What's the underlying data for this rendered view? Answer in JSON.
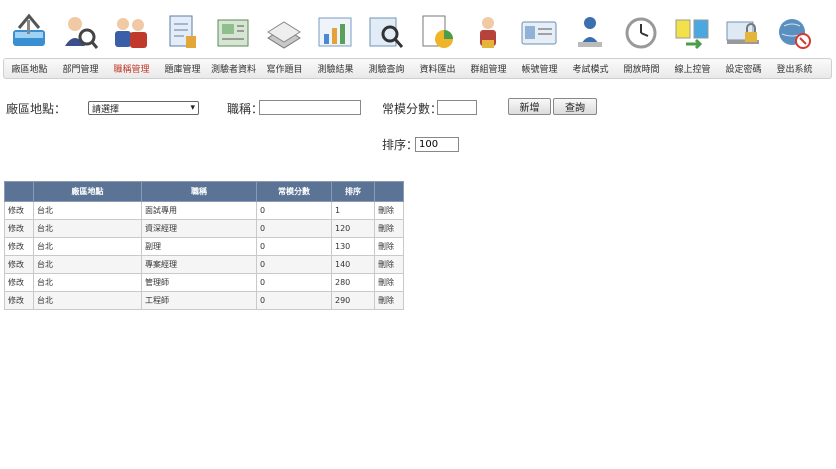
{
  "toolbar": {
    "icons": [
      "site-icon",
      "department-icon",
      "job-title-icon",
      "question-bank-icon",
      "examinee-icon",
      "exam-question-icon",
      "results-chart-icon",
      "query-icon",
      "export-icon",
      "group-icon",
      "account-card-icon",
      "exam-mode-icon",
      "clock-icon",
      "online-monitor-icon",
      "password-lock-icon",
      "logout-icon"
    ]
  },
  "menu": {
    "items": [
      "廠區地點",
      "部門管理",
      "職稱管理",
      "題庫管理",
      "測驗者資料",
      "寫作題目",
      "測驗結果",
      "測驗查詢",
      "資料匯出",
      "群組管理",
      "帳號管理",
      "考試模式",
      "開放時間",
      "線上控管",
      "設定密碼",
      "登出系統"
    ],
    "active_index": 2
  },
  "form": {
    "site_label": "廠區地點：",
    "site_value": "請選擇",
    "title_label": "職稱：",
    "title_value": "",
    "score_label": "常模分數：",
    "score_value": "",
    "add_button": "新增",
    "query_button": "查詢",
    "sort_label": "排序：",
    "sort_value": "100"
  },
  "table": {
    "headers": [
      "",
      "廠區地點",
      "職稱",
      "常模分數",
      "排序",
      ""
    ],
    "rows": [
      {
        "edit": "修改",
        "site": "台北",
        "title": "面試專用",
        "score": "0",
        "order": "1",
        "delete": "刪除"
      },
      {
        "edit": "修改",
        "site": "台北",
        "title": "資深經理",
        "score": "0",
        "order": "120",
        "delete": "刪除"
      },
      {
        "edit": "修改",
        "site": "台北",
        "title": "副理",
        "score": "0",
        "order": "130",
        "delete": "刪除"
      },
      {
        "edit": "修改",
        "site": "台北",
        "title": "專案經理",
        "score": "0",
        "order": "140",
        "delete": "刪除"
      },
      {
        "edit": "修改",
        "site": "台北",
        "title": "管理師",
        "score": "0",
        "order": "280",
        "delete": "刪除"
      },
      {
        "edit": "修改",
        "site": "台北",
        "title": "工程師",
        "score": "0",
        "order": "290",
        "delete": "刪除"
      }
    ]
  },
  "colors": {
    "header_bg": "#5b7394",
    "active_menu": "#c0392b"
  }
}
